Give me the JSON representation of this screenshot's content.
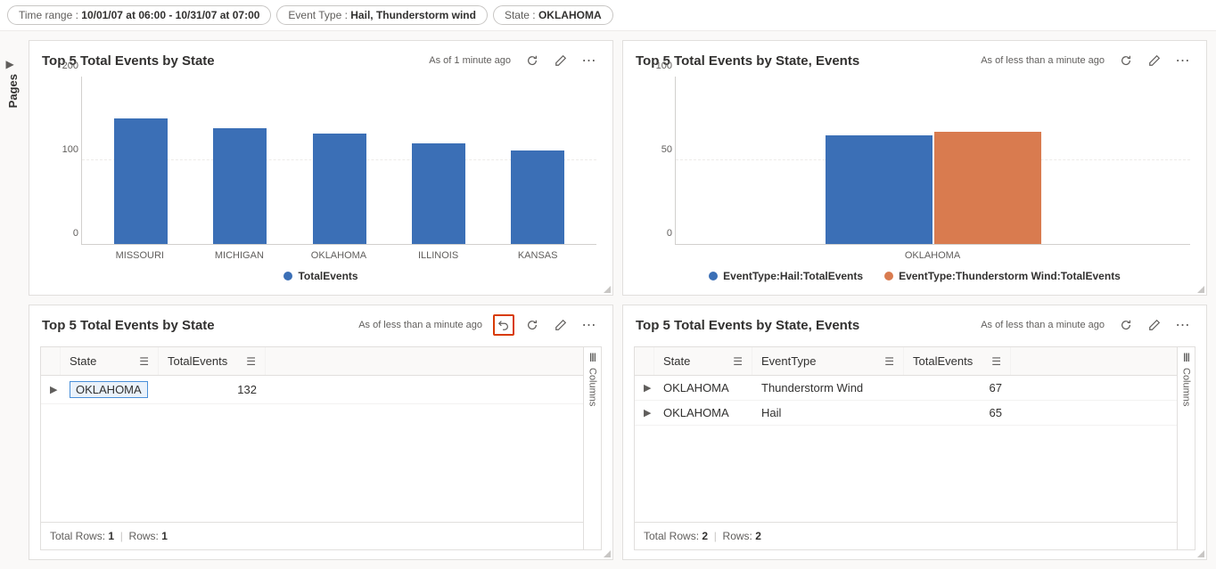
{
  "filters": {
    "time_label": "Time range :",
    "time_value": "10/01/07 at 06:00 - 10/31/07 at 07:00",
    "etype_label": "Event Type :",
    "etype_value": "Hail, Thunderstorm wind",
    "state_label": "State :",
    "state_value": "OKLAHOMA"
  },
  "rail": {
    "pages": "Pages"
  },
  "tiles": {
    "tl": {
      "title": "Top 5 Total Events by State",
      "asof": "As of 1 minute ago"
    },
    "tr": {
      "title": "Top 5 Total Events by State, Events",
      "asof": "As of less than a minute ago"
    },
    "bl": {
      "title": "Top 5 Total Events by State",
      "asof": "As of less than a minute ago"
    },
    "br": {
      "title": "Top 5 Total Events by State, Events",
      "asof": "As of less than a minute ago"
    }
  },
  "chart_data": [
    {
      "type": "bar",
      "title": "Top 5 Total Events by State",
      "categories": [
        "MISSOURI",
        "MICHIGAN",
        "OKLAHOMA",
        "ILLINOIS",
        "KANSAS"
      ],
      "values": [
        150,
        138,
        132,
        120,
        112
      ],
      "ylim": [
        0,
        200
      ],
      "yticks": [
        0,
        100,
        200
      ],
      "legend": [
        "TotalEvents"
      ]
    },
    {
      "type": "bar",
      "title": "Top 5 Total Events by State, Events",
      "categories": [
        "OKLAHOMA"
      ],
      "series": [
        {
          "name": "EventType:Hail:TotalEvents",
          "values": [
            65
          ],
          "color": "#3b6fb6"
        },
        {
          "name": "EventType:Thunderstorm Wind:TotalEvents",
          "values": [
            67
          ],
          "color": "#d97b4f"
        }
      ],
      "ylim": [
        0,
        100
      ],
      "yticks": [
        0,
        50,
        100
      ],
      "legend": [
        "EventType:Hail:TotalEvents",
        "EventType:Thunderstorm Wind:TotalEvents"
      ]
    }
  ],
  "table_bl": {
    "cols": {
      "state": "State",
      "events": "TotalEvents"
    },
    "rows": [
      {
        "state": "OKLAHOMA",
        "events": "132"
      }
    ],
    "footer_a": "Total Rows:",
    "footer_a_v": "1",
    "footer_b": "Rows:",
    "footer_b_v": "1",
    "columns_label": "Columns"
  },
  "table_br": {
    "cols": {
      "state": "State",
      "etype": "EventType",
      "events": "TotalEvents"
    },
    "rows": [
      {
        "state": "OKLAHOMA",
        "etype": "Thunderstorm Wind",
        "events": "67"
      },
      {
        "state": "OKLAHOMA",
        "etype": "Hail",
        "events": "65"
      }
    ],
    "footer_a": "Total Rows:",
    "footer_a_v": "2",
    "footer_b": "Rows:",
    "footer_b_v": "2",
    "columns_label": "Columns"
  }
}
